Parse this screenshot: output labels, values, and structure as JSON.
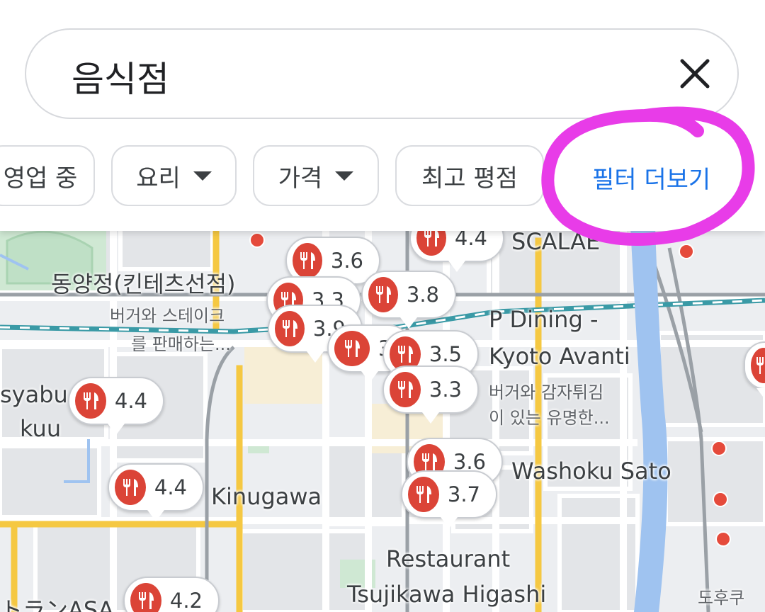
{
  "search": {
    "query": "음식점"
  },
  "chips": [
    {
      "label": "영업 중"
    },
    {
      "label": "요리"
    },
    {
      "label": "가격"
    },
    {
      "label": "최고 평점"
    }
  ],
  "more_filters_label": "필터 더보기",
  "pins": [
    {
      "rating": "4.4"
    },
    {
      "rating": "3.6"
    },
    {
      "rating": "3.8"
    },
    {
      "rating": "3.3"
    },
    {
      "rating": "3.9"
    },
    {
      "rating": "3"
    },
    {
      "rating": "3.5"
    },
    {
      "rating": "3.3"
    },
    {
      "rating": "4.4"
    },
    {
      "rating": "4.4"
    },
    {
      "rating": "3.6"
    },
    {
      "rating": "3.7"
    },
    {
      "rating": "4.2"
    }
  ],
  "places": {
    "p1_name": "동양정(킨테츠선점)",
    "p1_desc1": "버거와 스테이크",
    "p1_desc2": "를 판매하는...",
    "p2_name1": "P Dining -",
    "p2_name2": "Kyoto Avanti",
    "p2_desc1": "버거와 감자튀김",
    "p2_desc2": "이 있는 유명한...",
    "p3_name1": "syabu",
    "p3_name2": "kuu",
    "p4_name": "Kinugawa",
    "p5_name": "Washoku Sato",
    "p6_name1": "Restaurant",
    "p6_name2": "Tsujikawa Higashi",
    "p7_name": "トランASA",
    "p8_name": "SCALAE",
    "p9_name": "도후쿠"
  },
  "colors": {
    "accent": "#1a73e8",
    "pin_red": "#db4437",
    "annotation_magenta": "#e83ce8",
    "water": "#9fc3f0",
    "road_yellow": "#f5c842",
    "rail_teal": "#3a9aa6"
  },
  "icons": {
    "clear": "close-icon",
    "dropdown": "caret-down-icon",
    "restaurant": "fork-knife-icon"
  }
}
